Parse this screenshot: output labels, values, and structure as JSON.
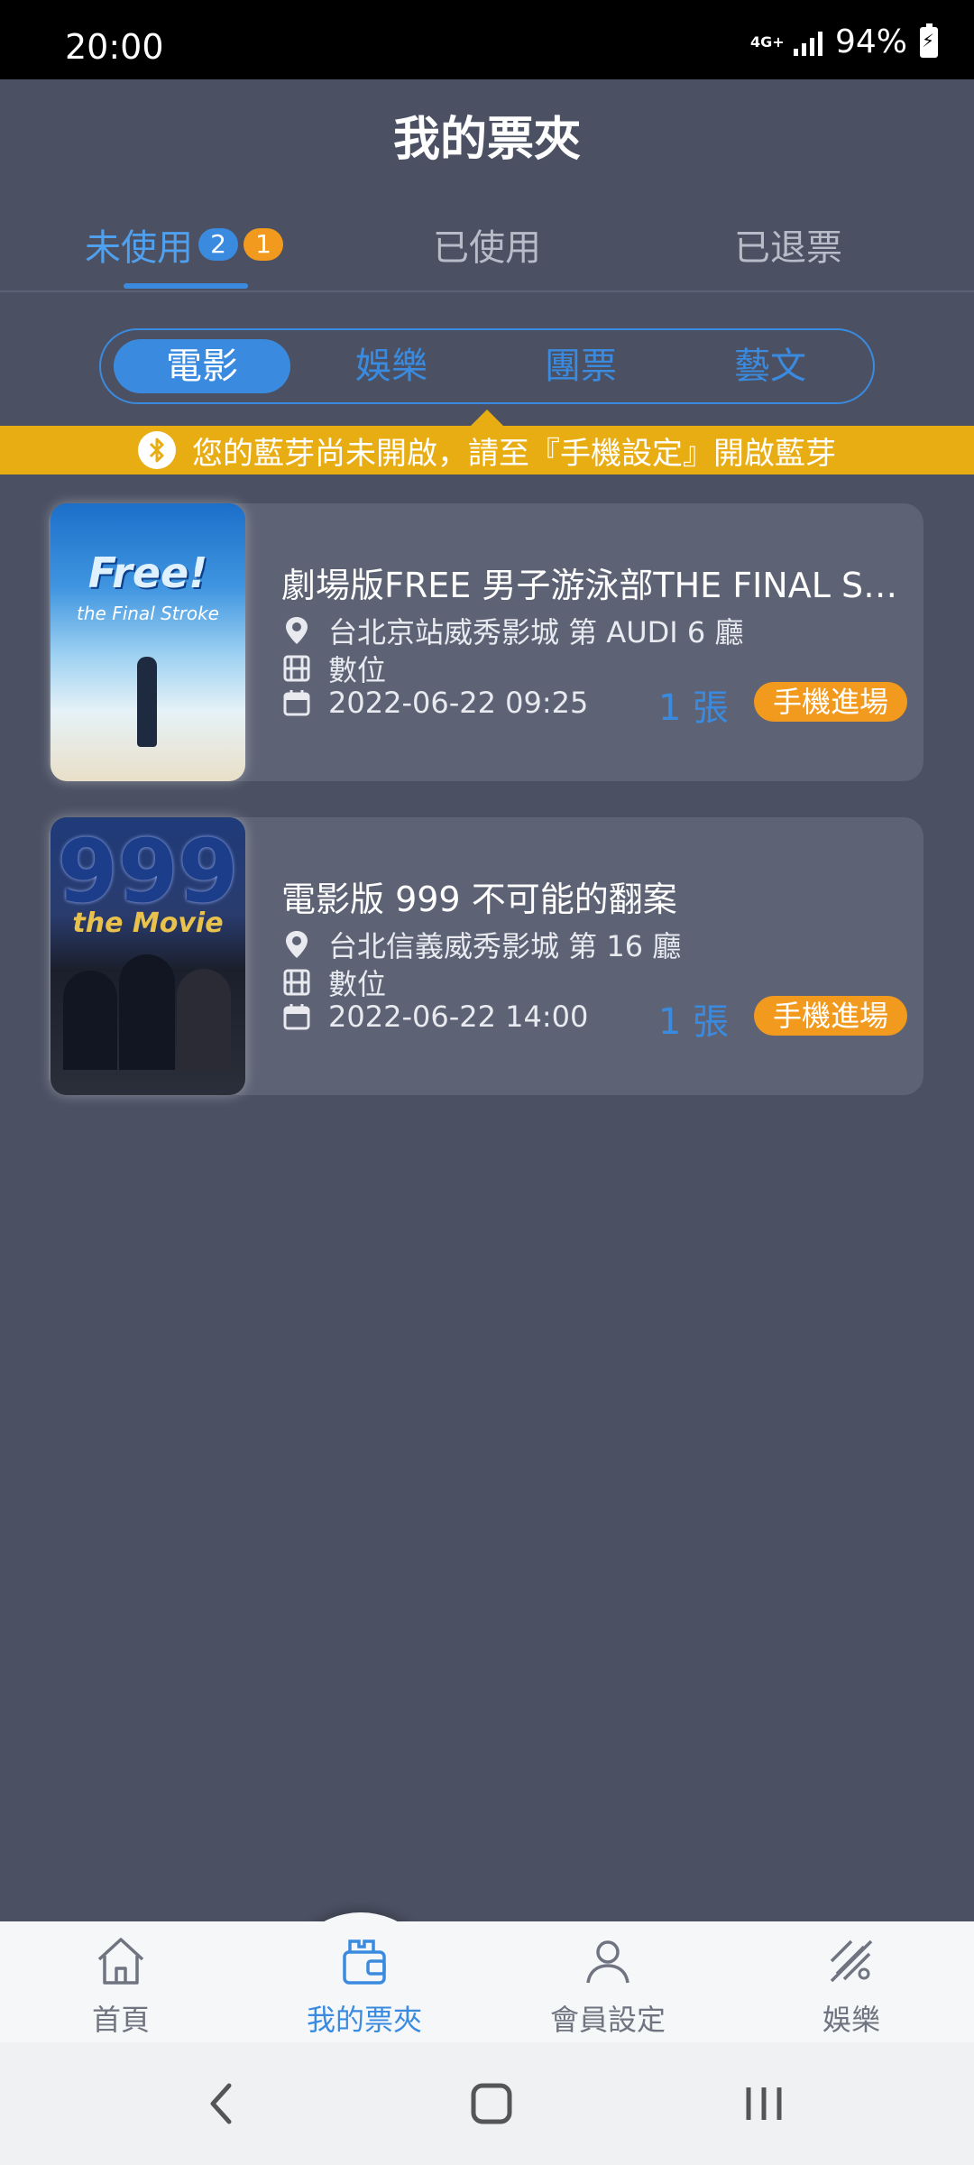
{
  "status_bar": {
    "time": "20:00",
    "network": "4G+",
    "battery_percent": "94%"
  },
  "header": {
    "title": "我的票夾"
  },
  "tabs": [
    {
      "label": "未使用",
      "badge_blue": "2",
      "badge_orange": "1",
      "active": true
    },
    {
      "label": "已使用",
      "active": false
    },
    {
      "label": "已退票",
      "active": false
    }
  ],
  "segments": [
    {
      "label": "電影",
      "active": true
    },
    {
      "label": "娛樂",
      "active": false
    },
    {
      "label": "團票",
      "active": false
    },
    {
      "label": "藝文",
      "active": false
    }
  ],
  "notice": {
    "text": "您的藍芽尚未開啟，請至『手機設定』開啟藍芽"
  },
  "tickets": [
    {
      "title": "劇場版FREE 男子游泳部THE FINAL STROKE",
      "location": "台北京站威秀影城 第 AUDI 6 廳",
      "format": "數位",
      "datetime": "2022-06-22 09:25",
      "count": "1 張",
      "action": "手機進場",
      "poster_text": "Free!",
      "poster_sub": "the Final Stroke"
    },
    {
      "title": "電影版 999 不可能的翻案",
      "location": "台北信義威秀影城 第 16 廳",
      "format": "數位",
      "datetime": "2022-06-22 14:00",
      "count": "1 張",
      "action": "手機進場",
      "poster_text": "999",
      "poster_sub": "the Movie"
    }
  ],
  "bottom_nav": [
    {
      "label": "首頁",
      "icon": "home-icon",
      "active": false
    },
    {
      "label": "我的票夾",
      "icon": "wallet-icon",
      "active": true
    },
    {
      "label": "會員設定",
      "icon": "user-icon",
      "active": false
    },
    {
      "label": "娛樂",
      "icon": "entertainment-icon",
      "active": false
    }
  ],
  "colors": {
    "background": "#4b5163",
    "accent_blue": "#3a8be0",
    "accent_orange": "#f29a1e",
    "notice_yellow": "#e9ad14",
    "card": "#5d6375"
  }
}
